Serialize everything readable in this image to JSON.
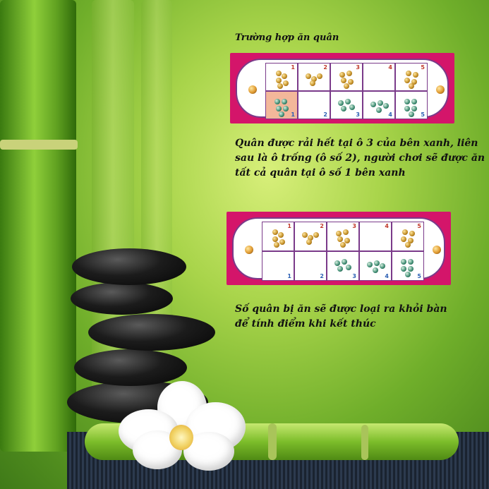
{
  "title": "Trường hợp ăn quân",
  "caption1": {
    "line1": "Quân được rải hết tại ô 3 của bên xanh, liên",
    "line2": "sau là ô trống (ô số 2), người chơi sẽ được ăn",
    "line3": "tất cả quân tại ô số 1 bên xanh"
  },
  "caption2": {
    "line1": "Số quân bị ăn sẽ được loại ra khỏi bàn",
    "line2": "để tính điểm khi kết thúc"
  },
  "board1": {
    "top_numbers": [
      "1",
      "2",
      "3",
      "4",
      "5"
    ],
    "bottom_numbers": [
      "1",
      "2",
      "3",
      "4",
      "5"
    ]
  },
  "board2": {
    "top_numbers": [
      "1",
      "2",
      "3",
      "4",
      "5"
    ],
    "bottom_numbers": [
      "1",
      "2",
      "3",
      "4",
      "5"
    ]
  },
  "colors": {
    "board_frame": "#d4156a",
    "highlight_cell": "#f3b79a",
    "top_number": "#c0392b",
    "bottom_number": "#2b5fb3"
  }
}
